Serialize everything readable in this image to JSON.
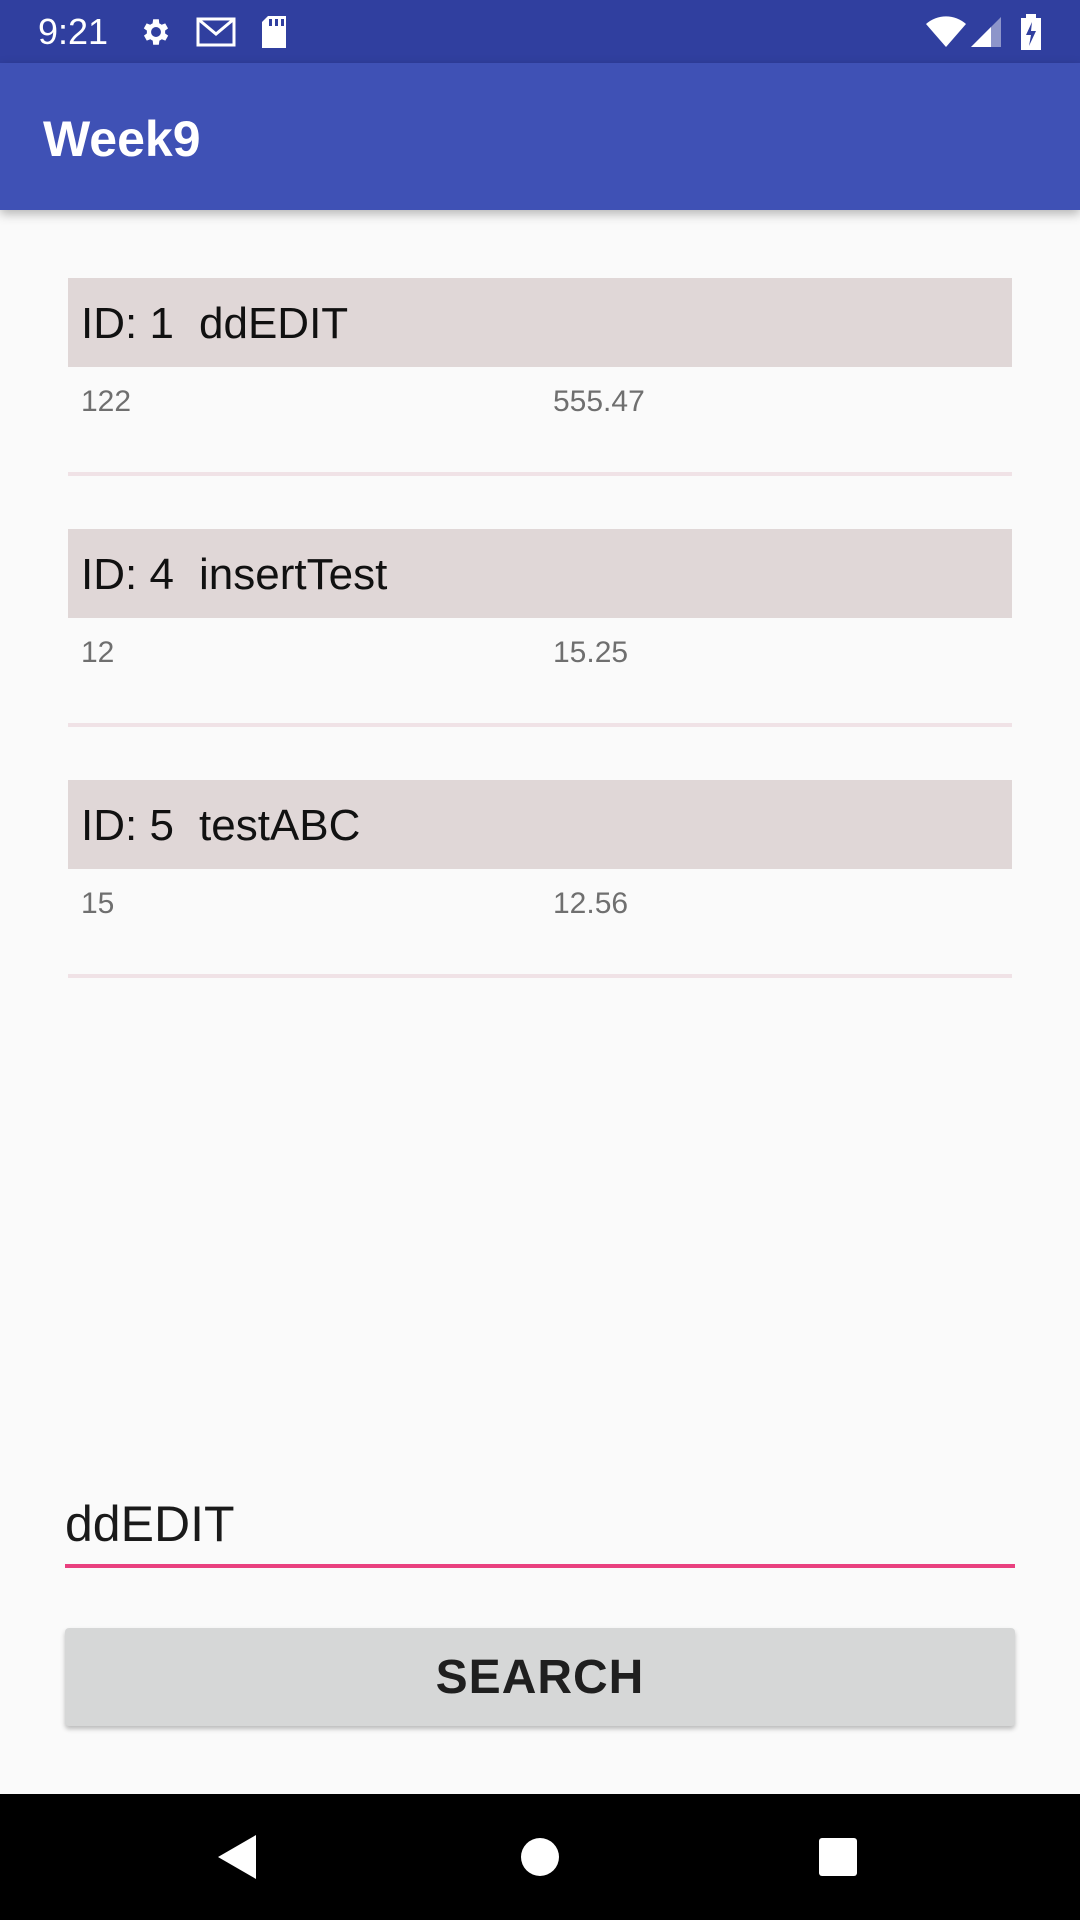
{
  "status_bar": {
    "time": "9:21",
    "left_icons": [
      "settings-icon",
      "gmail-icon",
      "sd-card-icon"
    ],
    "right_icons": [
      "wifi-icon",
      "signal-icon",
      "battery-charging-icon"
    ]
  },
  "app_bar": {
    "title": "Week9"
  },
  "records": [
    {
      "id_label": "ID: 1",
      "name": "ddEDIT",
      "quantity": "122",
      "price": "555.47"
    },
    {
      "id_label": "ID: 4",
      "name": "insertTest",
      "quantity": "12",
      "price": "15.25"
    },
    {
      "id_label": "ID: 5",
      "name": "testABC",
      "quantity": "15",
      "price": "12.56"
    }
  ],
  "search": {
    "value": "ddEDIT",
    "button_label": "SEARCH"
  },
  "nav_bar": {
    "icons": [
      "back-icon",
      "home-icon",
      "recents-icon"
    ]
  },
  "colors": {
    "status_bar": "#303f9f",
    "app_bar": "#3f51b5",
    "record_header": "#e0d7d7",
    "accent": "#e9407f",
    "button": "#d6d7d7"
  }
}
